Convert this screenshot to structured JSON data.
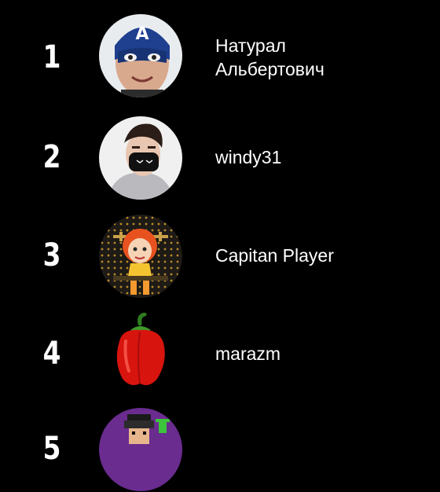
{
  "leaderboard": {
    "entries": [
      {
        "rank": "1",
        "name_line1": "Натурал",
        "name_line2": "Альбертович",
        "avatar_icon": "captain-mask-avatar-icon"
      },
      {
        "rank": "2",
        "name": "windy31",
        "avatar_icon": "masked-guy-avatar-icon"
      },
      {
        "rank": "3",
        "name": "Capitan Player",
        "avatar_icon": "cartoon-girl-avatar-icon"
      },
      {
        "rank": "4",
        "name": "marazm",
        "avatar_icon": "red-pepper-avatar-icon"
      },
      {
        "rank": "5",
        "avatar_icon": "pixel-avatar-icon"
      }
    ]
  },
  "colors": {
    "background": "#000000",
    "text": "#ffffff"
  }
}
